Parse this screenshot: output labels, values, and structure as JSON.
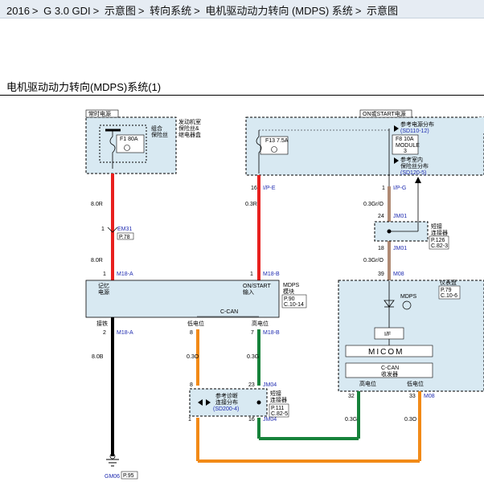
{
  "breadcrumb": [
    "2016",
    "G 3.0 GDI",
    "示意图",
    "转向系统",
    "电机驱动动力转向 (MDPS) 系统",
    "示意图"
  ],
  "diagram_title": "电机驱动动力转向(MDPS)系统(1)",
  "labels": {
    "hot_power": "常时电源",
    "engine_room_box": [
      "发动机室",
      "保险丝&",
      "继电器盒"
    ],
    "fusible_link": [
      "组合",
      "保险丝"
    ],
    "f1_fuse": "F1 80A",
    "on_start_power": "ON或START电源",
    "ref_power_dist": "参考电源分布",
    "ref_power_dist_code": "(SD110-12)",
    "f13_fuse": "F13 7.5A",
    "f8_fuse": "F8 10A",
    "module": "MODULE",
    "module_num": "3",
    "ref_indoor": "参考室内",
    "ref_fuse_dist": "保险丝分布",
    "ref_fuse_dist_code": "(SD120-5)",
    "pin16": "16",
    "ip_e": "I/P-E",
    "pin1_ipg": "1",
    "ip_g": "I/P-G",
    "w_80r": "8.0R",
    "w_03r": "0.3R",
    "w_03gro_a": "0.3Gr/O",
    "em31_pin": "1",
    "em31": "EM31",
    "p78": "P.78",
    "jm01_pin24": "24",
    "jm01_a": "JM01",
    "short_conn": [
      "短接",
      "连接器"
    ],
    "p126": "P.126",
    "c823": "C.82-3",
    "jm01_pin18": "18",
    "jm01_b": "JM01",
    "w_80r_b": "8.0R",
    "w_03gro_b": "0.3Gr/O",
    "m18a_pin1": "1",
    "m18a": "M18-A",
    "m18b_pin1": "1",
    "m18b": "M18-B",
    "m08_pin39": "39",
    "m08": "M08",
    "memory_power": [
      "记忆",
      "电源"
    ],
    "on_start_input": [
      "ON/START",
      "输入"
    ],
    "mdps_module": [
      "MDPS",
      "模块"
    ],
    "p90": "P.90",
    "c1014": "C.10-14",
    "cluster": "仪表盘",
    "p79": "P.79",
    "c106": "C.10-6",
    "mdps_lamp": "MDPS",
    "ccan": "C-CAN",
    "ground_lbl": "接铁",
    "low_level": "低电位",
    "high_level": "高电位",
    "pin2": "2",
    "m18a_b": "M18-A",
    "pin8a": "8",
    "pin7": "7",
    "m18b_b": "M18-B",
    "if_box": "I/F",
    "micom": "MICOM",
    "ccan_box": "C-CAN",
    "transceiver": "收发器",
    "w_80b": "8.0B",
    "w_03o_a": "0.3O",
    "w_03g_a": "0.3G",
    "cl_high": "高电位",
    "cl_low": "低电位",
    "pin32": "32",
    "pin33": "33",
    "m08_b": "M08",
    "pin8b": "8",
    "pin23": "23",
    "jm04_a": "JM04",
    "ref_diag": [
      "参考诊断",
      "连接分布"
    ],
    "sd2004": "(SD200-4)",
    "short_conn_b": [
      "短接",
      "连接器"
    ],
    "p111": "P.111",
    "c825": "C.82-5",
    "pin1b": "1",
    "pin16b": "16",
    "jm04_b": "JM04",
    "w_03g_b": "0.3G",
    "w_03o_b": "0.3O",
    "gm06": "GM06",
    "p95": "P.95"
  },
  "colors": {
    "red_wire": "#e8201e",
    "brown_wire": "#b08a74",
    "black_wire": "#000000",
    "orange_wire": "#f28a17",
    "green_wire": "#16823a",
    "module_fill": "#d8e9f2",
    "ref_blue": "#1f2bb0"
  }
}
